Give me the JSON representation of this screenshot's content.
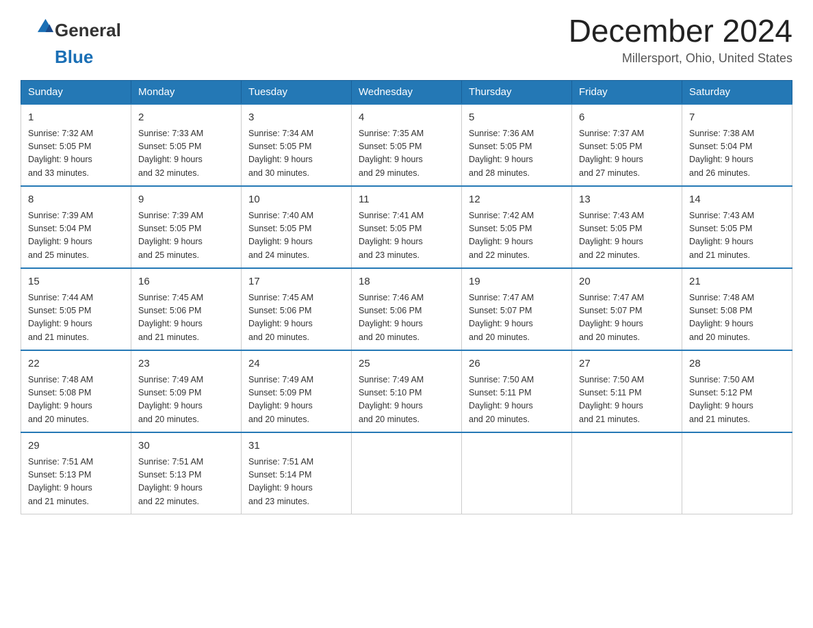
{
  "header": {
    "logo_general": "General",
    "logo_blue": "Blue",
    "title": "December 2024",
    "subtitle": "Millersport, Ohio, United States"
  },
  "calendar": {
    "days": [
      "Sunday",
      "Monday",
      "Tuesday",
      "Wednesday",
      "Thursday",
      "Friday",
      "Saturday"
    ],
    "weeks": [
      [
        {
          "date": "1",
          "sunrise": "7:32 AM",
          "sunset": "5:05 PM",
          "daylight": "9 hours and 33 minutes."
        },
        {
          "date": "2",
          "sunrise": "7:33 AM",
          "sunset": "5:05 PM",
          "daylight": "9 hours and 32 minutes."
        },
        {
          "date": "3",
          "sunrise": "7:34 AM",
          "sunset": "5:05 PM",
          "daylight": "9 hours and 30 minutes."
        },
        {
          "date": "4",
          "sunrise": "7:35 AM",
          "sunset": "5:05 PM",
          "daylight": "9 hours and 29 minutes."
        },
        {
          "date": "5",
          "sunrise": "7:36 AM",
          "sunset": "5:05 PM",
          "daylight": "9 hours and 28 minutes."
        },
        {
          "date": "6",
          "sunrise": "7:37 AM",
          "sunset": "5:05 PM",
          "daylight": "9 hours and 27 minutes."
        },
        {
          "date": "7",
          "sunrise": "7:38 AM",
          "sunset": "5:04 PM",
          "daylight": "9 hours and 26 minutes."
        }
      ],
      [
        {
          "date": "8",
          "sunrise": "7:39 AM",
          "sunset": "5:04 PM",
          "daylight": "9 hours and 25 minutes."
        },
        {
          "date": "9",
          "sunrise": "7:39 AM",
          "sunset": "5:05 PM",
          "daylight": "9 hours and 25 minutes."
        },
        {
          "date": "10",
          "sunrise": "7:40 AM",
          "sunset": "5:05 PM",
          "daylight": "9 hours and 24 minutes."
        },
        {
          "date": "11",
          "sunrise": "7:41 AM",
          "sunset": "5:05 PM",
          "daylight": "9 hours and 23 minutes."
        },
        {
          "date": "12",
          "sunrise": "7:42 AM",
          "sunset": "5:05 PM",
          "daylight": "9 hours and 22 minutes."
        },
        {
          "date": "13",
          "sunrise": "7:43 AM",
          "sunset": "5:05 PM",
          "daylight": "9 hours and 22 minutes."
        },
        {
          "date": "14",
          "sunrise": "7:43 AM",
          "sunset": "5:05 PM",
          "daylight": "9 hours and 21 minutes."
        }
      ],
      [
        {
          "date": "15",
          "sunrise": "7:44 AM",
          "sunset": "5:05 PM",
          "daylight": "9 hours and 21 minutes."
        },
        {
          "date": "16",
          "sunrise": "7:45 AM",
          "sunset": "5:06 PM",
          "daylight": "9 hours and 21 minutes."
        },
        {
          "date": "17",
          "sunrise": "7:45 AM",
          "sunset": "5:06 PM",
          "daylight": "9 hours and 20 minutes."
        },
        {
          "date": "18",
          "sunrise": "7:46 AM",
          "sunset": "5:06 PM",
          "daylight": "9 hours and 20 minutes."
        },
        {
          "date": "19",
          "sunrise": "7:47 AM",
          "sunset": "5:07 PM",
          "daylight": "9 hours and 20 minutes."
        },
        {
          "date": "20",
          "sunrise": "7:47 AM",
          "sunset": "5:07 PM",
          "daylight": "9 hours and 20 minutes."
        },
        {
          "date": "21",
          "sunrise": "7:48 AM",
          "sunset": "5:08 PM",
          "daylight": "9 hours and 20 minutes."
        }
      ],
      [
        {
          "date": "22",
          "sunrise": "7:48 AM",
          "sunset": "5:08 PM",
          "daylight": "9 hours and 20 minutes."
        },
        {
          "date": "23",
          "sunrise": "7:49 AM",
          "sunset": "5:09 PM",
          "daylight": "9 hours and 20 minutes."
        },
        {
          "date": "24",
          "sunrise": "7:49 AM",
          "sunset": "5:09 PM",
          "daylight": "9 hours and 20 minutes."
        },
        {
          "date": "25",
          "sunrise": "7:49 AM",
          "sunset": "5:10 PM",
          "daylight": "9 hours and 20 minutes."
        },
        {
          "date": "26",
          "sunrise": "7:50 AM",
          "sunset": "5:11 PM",
          "daylight": "9 hours and 20 minutes."
        },
        {
          "date": "27",
          "sunrise": "7:50 AM",
          "sunset": "5:11 PM",
          "daylight": "9 hours and 21 minutes."
        },
        {
          "date": "28",
          "sunrise": "7:50 AM",
          "sunset": "5:12 PM",
          "daylight": "9 hours and 21 minutes."
        }
      ],
      [
        {
          "date": "29",
          "sunrise": "7:51 AM",
          "sunset": "5:13 PM",
          "daylight": "9 hours and 21 minutes."
        },
        {
          "date": "30",
          "sunrise": "7:51 AM",
          "sunset": "5:13 PM",
          "daylight": "9 hours and 22 minutes."
        },
        {
          "date": "31",
          "sunrise": "7:51 AM",
          "sunset": "5:14 PM",
          "daylight": "9 hours and 23 minutes."
        },
        null,
        null,
        null,
        null
      ]
    ],
    "labels": {
      "sunrise": "Sunrise:",
      "sunset": "Sunset:",
      "daylight": "Daylight:"
    }
  }
}
